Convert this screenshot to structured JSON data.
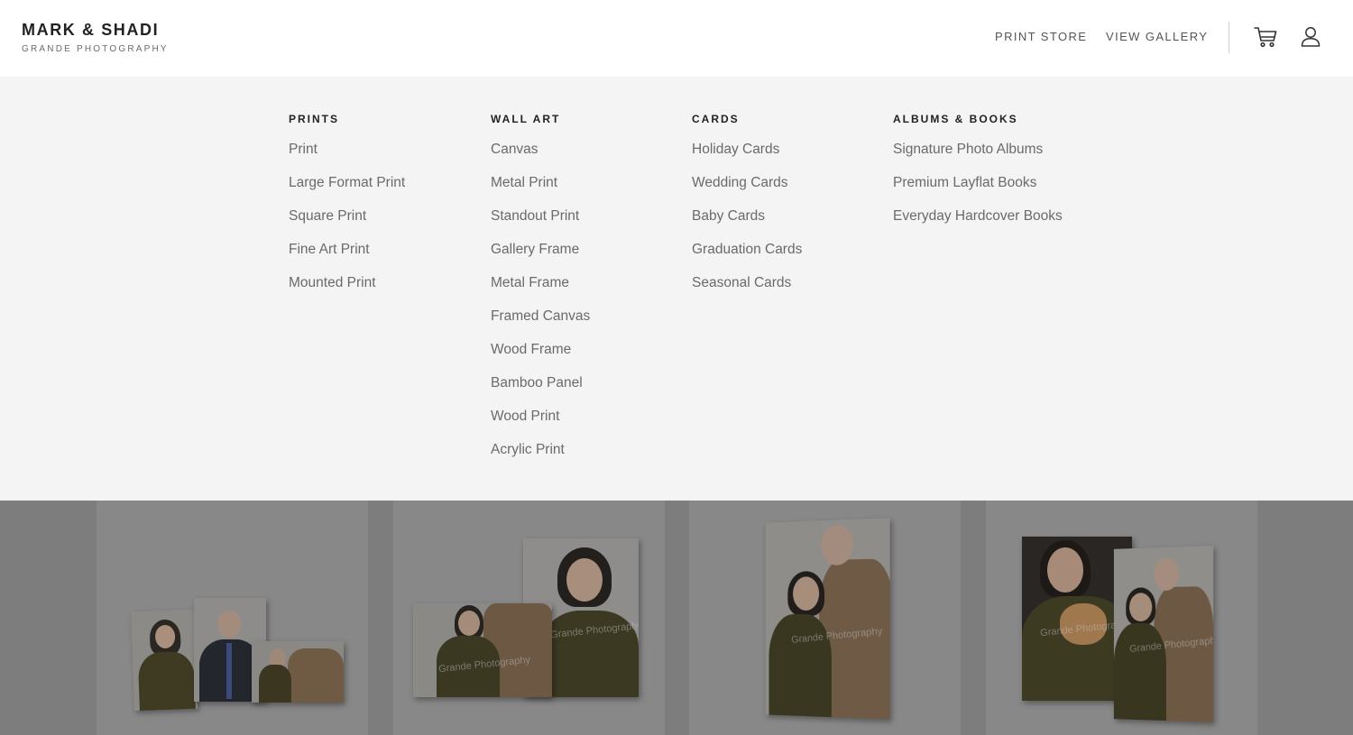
{
  "brand": {
    "title": "MARK & SHADI",
    "subtitle": "GRANDE PHOTOGRAPHY"
  },
  "nav": {
    "print_store": "PRINT STORE",
    "view_gallery": "VIEW GALLERY",
    "cart_icon": "cart-icon",
    "account_icon": "user-icon"
  },
  "menu": {
    "columns": [
      {
        "heading": "PRINTS",
        "items": [
          "Print",
          "Large Format Print",
          "Square Print",
          "Fine Art Print",
          "Mounted Print"
        ]
      },
      {
        "heading": "WALL ART",
        "items": [
          "Canvas",
          "Metal Print",
          "Standout Print",
          "Gallery Frame",
          "Metal Frame",
          "Framed Canvas",
          "Wood Frame",
          "Bamboo Panel",
          "Wood Print",
          "Acrylic Print"
        ]
      },
      {
        "heading": "CARDS",
        "items": [
          "Holiday Cards",
          "Wedding Cards",
          "Baby Cards",
          "Graduation Cards",
          "Seasonal Cards"
        ]
      },
      {
        "heading": "ALBUMS & BOOKS",
        "items": [
          "Signature Photo Albums",
          "Premium Layflat Books",
          "Everyday Hardcover Books"
        ]
      }
    ]
  },
  "products": {
    "watermark": "Grande Photography"
  },
  "colors": {
    "header_bg": "#ffffff",
    "menu_bg": "#f4f4f4",
    "heading_text": "#222222",
    "item_text": "#6a6a6a"
  }
}
